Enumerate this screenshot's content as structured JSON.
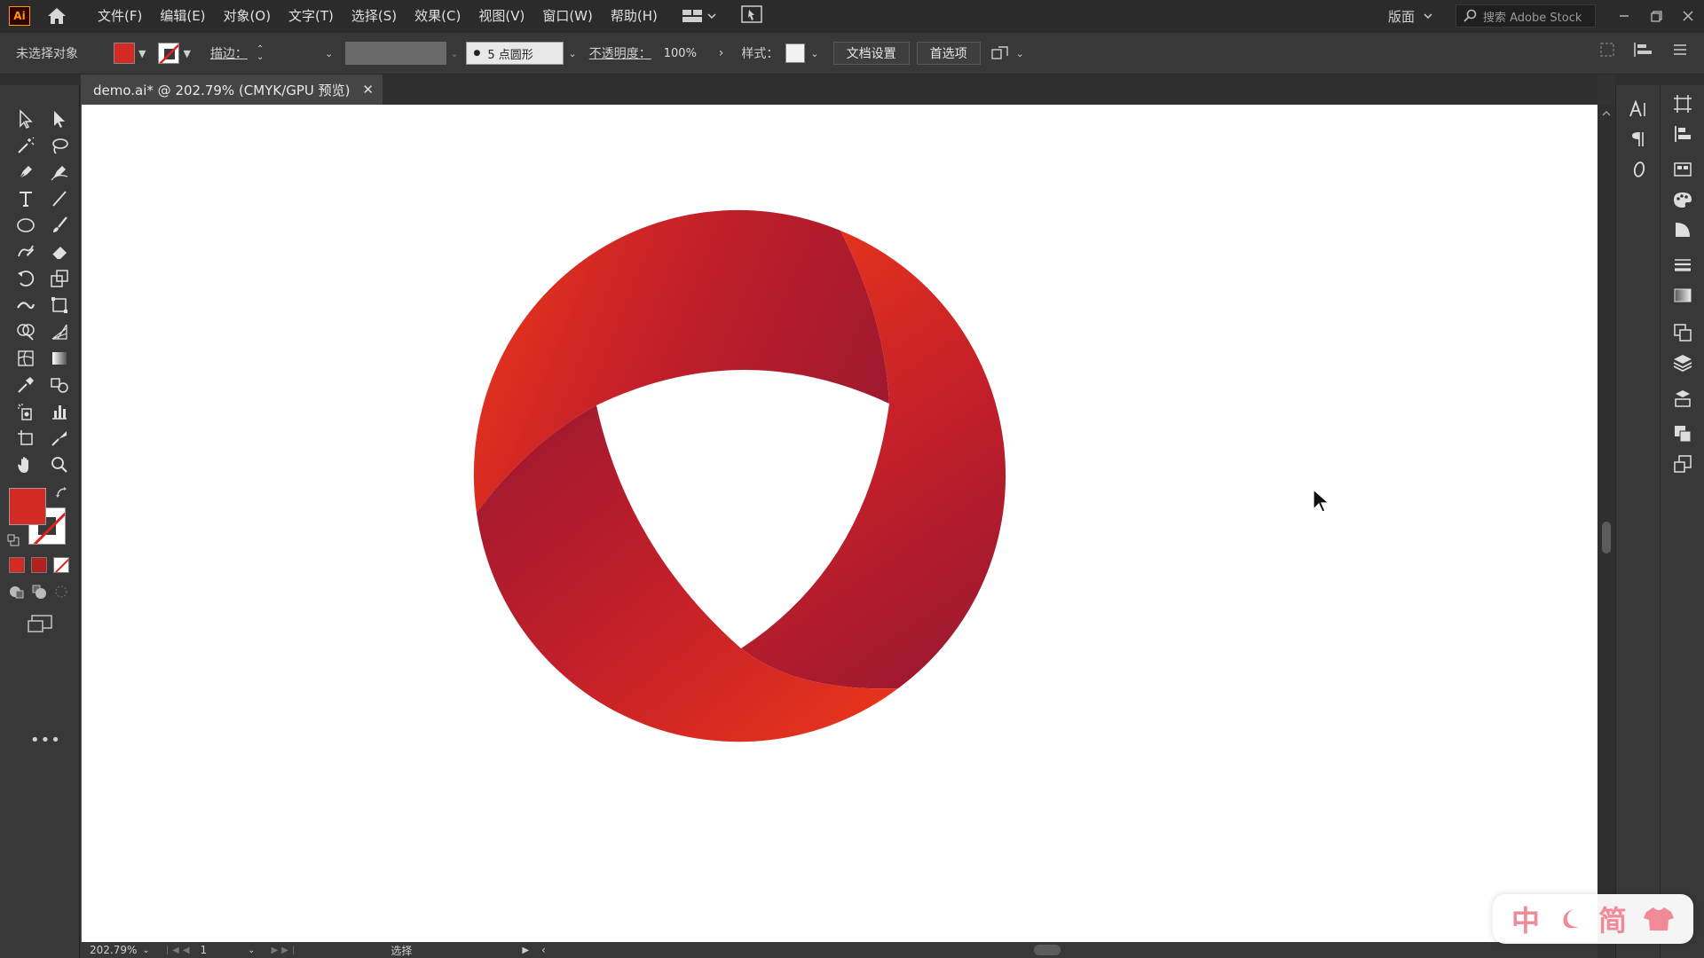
{
  "app": {
    "logo_text": "Ai",
    "menu": [
      "文件(F)",
      "编辑(E)",
      "对象(O)",
      "文字(T)",
      "选择(S)",
      "效果(C)",
      "视图(V)",
      "窗口(W)",
      "帮助(H)"
    ],
    "workspace_label": "版面",
    "stock_search_placeholder": "搜索 Adobe Stock"
  },
  "control_bar": {
    "selection_status": "未选择对象",
    "stroke_label": "描边：",
    "brush_label": "5 点圆形",
    "opacity_label": "不透明度：",
    "opacity_value": "100%",
    "style_label": "样式：",
    "doc_setup_button": "文档设置",
    "preferences_button": "首选项",
    "fill_color": "#d42a24"
  },
  "document": {
    "tab_title": "demo.ai* @ 202.79% (CMYK/GPU 预览)",
    "close_symbol": "✕"
  },
  "artwork": {
    "colors": {
      "bright_red": "#e8341b",
      "crimson": "#c21f2a",
      "dark_red": "#a0192f"
    }
  },
  "status_bar": {
    "zoom": "202.79%",
    "artboard_number": "1",
    "tool_status": "选择"
  },
  "watermark": {
    "chars": [
      "中",
      "简"
    ]
  }
}
